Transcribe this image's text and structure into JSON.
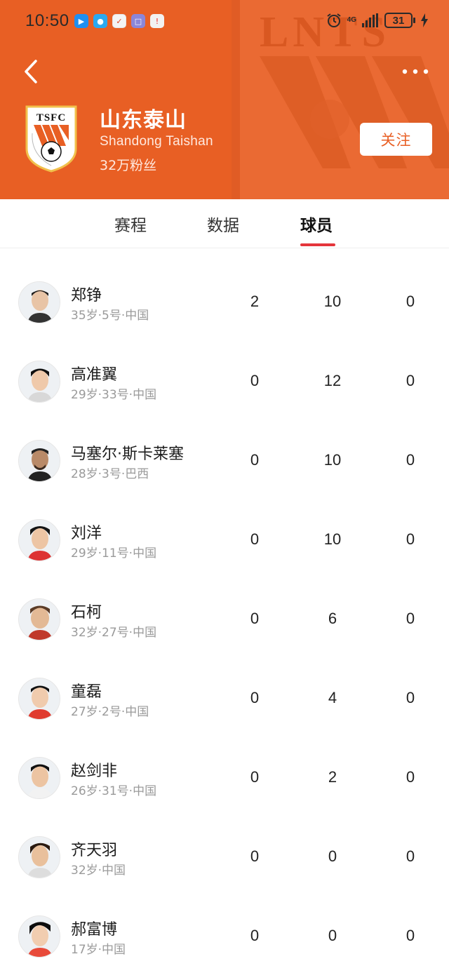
{
  "status_bar": {
    "time": "10:50",
    "network_label": "4G",
    "battery_level": "31",
    "icons": [
      "bluetooth-app-icon",
      "message-app-icon",
      "security-app-icon",
      "shop-app-icon",
      "alert-app-icon",
      "alarm-icon",
      "signal-icon",
      "charging-icon"
    ]
  },
  "header": {
    "background_color": "#e85f24",
    "watermark_text": "LNTS",
    "team_name": "山东泰山",
    "team_name_en": "Shandong Taishan",
    "fans": "32万粉丝",
    "follow_label": "关注",
    "logo_text": "TSFC"
  },
  "tabs": [
    {
      "label": "赛程",
      "active": false
    },
    {
      "label": "数据",
      "active": false
    },
    {
      "label": "球员",
      "active": true
    }
  ],
  "accent_color": "#e4353b",
  "players": [
    {
      "name": "郑铮",
      "info": "35岁·5号·中国",
      "stats": [
        "2",
        "10",
        "0"
      ]
    },
    {
      "name": "高准翼",
      "info": "29岁·33号·中国",
      "stats": [
        "0",
        "12",
        "0"
      ]
    },
    {
      "name": "马塞尔·斯卡莱塞",
      "info": "28岁·3号·巴西",
      "stats": [
        "0",
        "10",
        "0"
      ]
    },
    {
      "name": "刘洋",
      "info": "29岁·11号·中国",
      "stats": [
        "0",
        "10",
        "0"
      ]
    },
    {
      "name": "石柯",
      "info": "32岁·27号·中国",
      "stats": [
        "0",
        "6",
        "0"
      ]
    },
    {
      "name": "童磊",
      "info": "27岁·2号·中国",
      "stats": [
        "0",
        "4",
        "0"
      ]
    },
    {
      "name": "赵剑非",
      "info": "26岁·31号·中国",
      "stats": [
        "0",
        "2",
        "0"
      ]
    },
    {
      "name": "齐天羽",
      "info": "32岁·中国",
      "stats": [
        "0",
        "0",
        "0"
      ]
    },
    {
      "name": "郝富博",
      "info": "17岁·中国",
      "stats": [
        "0",
        "0",
        "0"
      ]
    }
  ]
}
